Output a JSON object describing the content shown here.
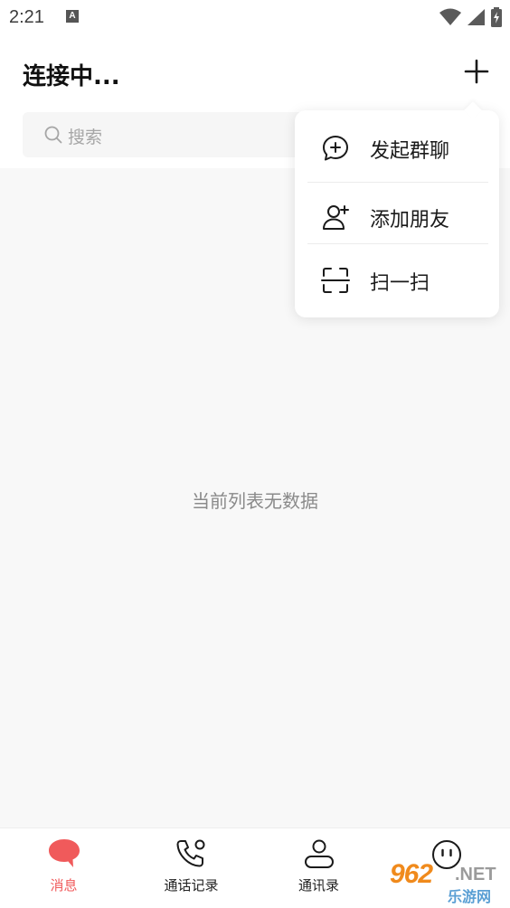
{
  "status_bar": {
    "time": "2:21",
    "notification_icon": "a-letter-icon",
    "icons": [
      "wifi-icon",
      "signal-icon",
      "battery-charging-icon"
    ]
  },
  "header": {
    "title": "连接中...",
    "add_icon": "plus-icon"
  },
  "search": {
    "placeholder": "搜索",
    "icon": "search-icon"
  },
  "main": {
    "empty_text": "当前列表无数据"
  },
  "popup_menu": {
    "items": [
      {
        "label": "发起群聊",
        "icon": "chat-add-icon"
      },
      {
        "label": "添加朋友",
        "icon": "add-user-icon"
      },
      {
        "label": "扫一扫",
        "icon": "scan-icon"
      }
    ]
  },
  "bottom_nav": {
    "items": [
      {
        "label": "消息",
        "icon": "message-bubble-icon",
        "active": true
      },
      {
        "label": "通话记录",
        "icon": "phone-icon",
        "active": false
      },
      {
        "label": "通讯录",
        "icon": "contacts-icon",
        "active": false
      },
      {
        "label": "",
        "icon": "smiley-icon",
        "active": false
      }
    ]
  },
  "watermark": {
    "brand": "962",
    "suffix": ".NET",
    "site_cn": "乐游网"
  },
  "colors": {
    "accent": "#f05a5b",
    "background": "#f8f8f8",
    "watermark_orange": "#f08a1c"
  }
}
